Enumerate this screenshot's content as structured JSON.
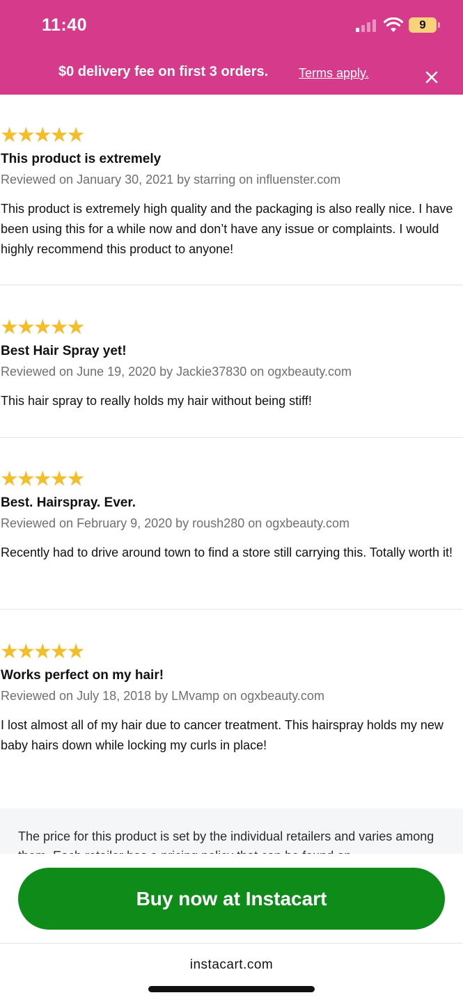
{
  "status_bar": {
    "time": "11:40",
    "battery": "9",
    "icons": [
      "cellular-signal-icon",
      "wifi-icon",
      "battery-icon"
    ]
  },
  "promo": {
    "text": "$0 delivery fee on first 3 orders.",
    "link": "Terms apply.",
    "close_icon": "close-icon"
  },
  "reviews": [
    {
      "stars": "★★★★★",
      "rating": 5,
      "title": "This product is extremely",
      "meta": "Reviewed on January 30, 2021 by starring on influenster.com",
      "body": "This product is extremely high quality and the packaging is also really nice. I have been using this for a while now and don’t have any issue or complaints. I would highly recommend this product to anyone!"
    },
    {
      "stars": "★★★★★",
      "rating": 5,
      "title": "Best Hair Spray yet!",
      "meta": "Reviewed on June 19, 2020 by Jackie37830 on ogxbeauty.com",
      "body": "This hair spray to really holds my hair without being stiff!"
    },
    {
      "stars": "★★★★★",
      "rating": 5,
      "title": "Best. Hairspray. Ever.",
      "meta": "Reviewed on February 9, 2020 by roush280 on ogxbeauty.com",
      "body": "Recently had to drive around town to find a store still carrying this. Totally worth it!"
    },
    {
      "stars": "★★★★★",
      "rating": 5,
      "title": "Works perfect on my hair!",
      "meta": "Reviewed on July 18, 2018 by LMvamp on ogxbeauty.com",
      "body": "I lost almost all of my hair due to cancer treatment. This hairspray holds my new baby hairs down while locking my curls in place!"
    }
  ],
  "disclaimer": "The price for this product is set by the individual retailers and varies among them. Each retailer has a pricing policy that can be found on",
  "cta": {
    "label": "Buy now at Instacart",
    "domain": "instacart.com"
  },
  "colors": {
    "brand_pink": "#d63a8a",
    "star": "#f4bd2c",
    "cta_green": "#0f8b1a"
  }
}
